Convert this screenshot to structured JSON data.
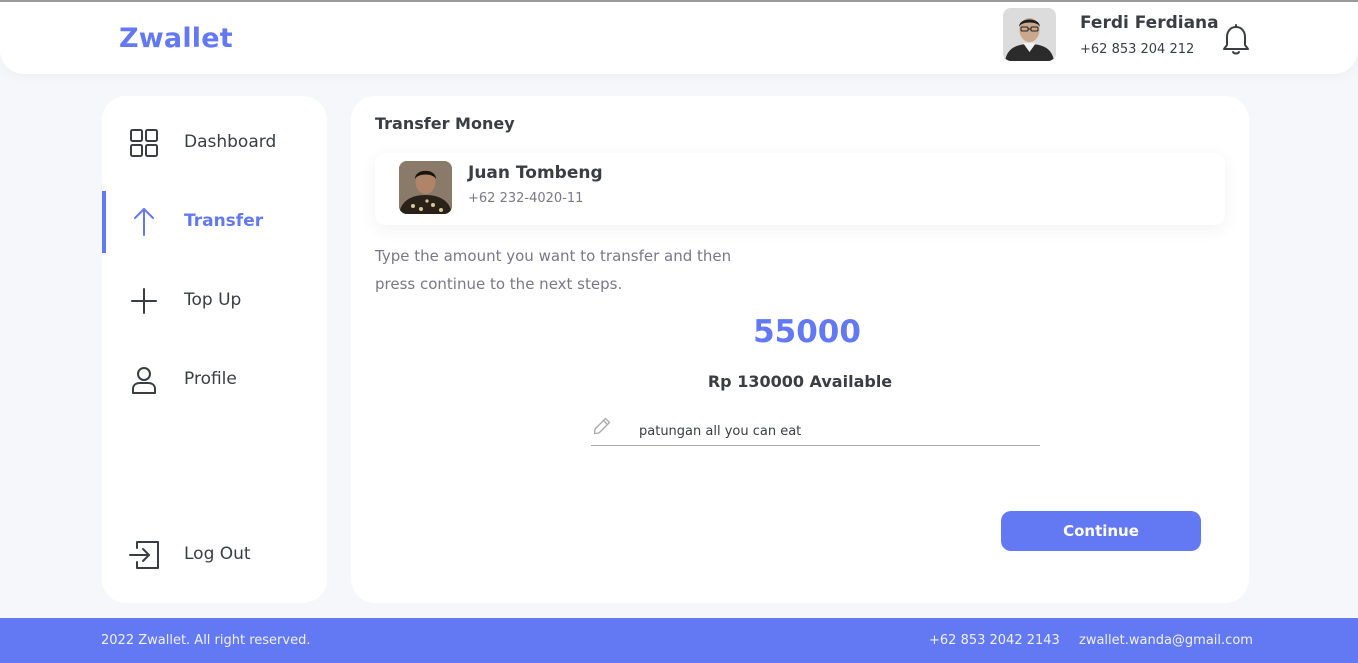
{
  "header": {
    "logo": "Zwallet",
    "user": {
      "name": "Ferdi Ferdiana",
      "phone": "+62 853 204 212",
      "avatar_icon": "user-photo"
    },
    "notification_icon": "bell-icon"
  },
  "sidebar": {
    "items": [
      {
        "label": "Dashboard",
        "icon": "grid-icon",
        "active": false
      },
      {
        "label": "Transfer",
        "icon": "arrow-up-icon",
        "active": true
      },
      {
        "label": "Top Up",
        "icon": "plus-icon",
        "active": false
      },
      {
        "label": "Profile",
        "icon": "user-icon",
        "active": false
      }
    ],
    "logout": {
      "label": "Log Out",
      "icon": "logout-icon"
    }
  },
  "main": {
    "title": "Transfer Money",
    "receiver": {
      "name": "Juan Tombeng",
      "phone": "+62 232-4020-11"
    },
    "instruction": "Type the amount you want to transfer and then press continue to the next steps.",
    "amount": "55000",
    "available": "Rp 130000 Available",
    "note": {
      "value": "patungan all you can eat",
      "icon": "pencil-icon"
    },
    "continue_label": "Continue"
  },
  "footer": {
    "copyright": "2022 Zwallet. All right reserved.",
    "phone": "+62 853 2042 2143",
    "email": "zwallet.wanda@gmail.com"
  },
  "colors": {
    "accent": "#6379f4",
    "text": "#3a3d42",
    "muted": "#7a7886",
    "background": "#f6f7fb"
  }
}
